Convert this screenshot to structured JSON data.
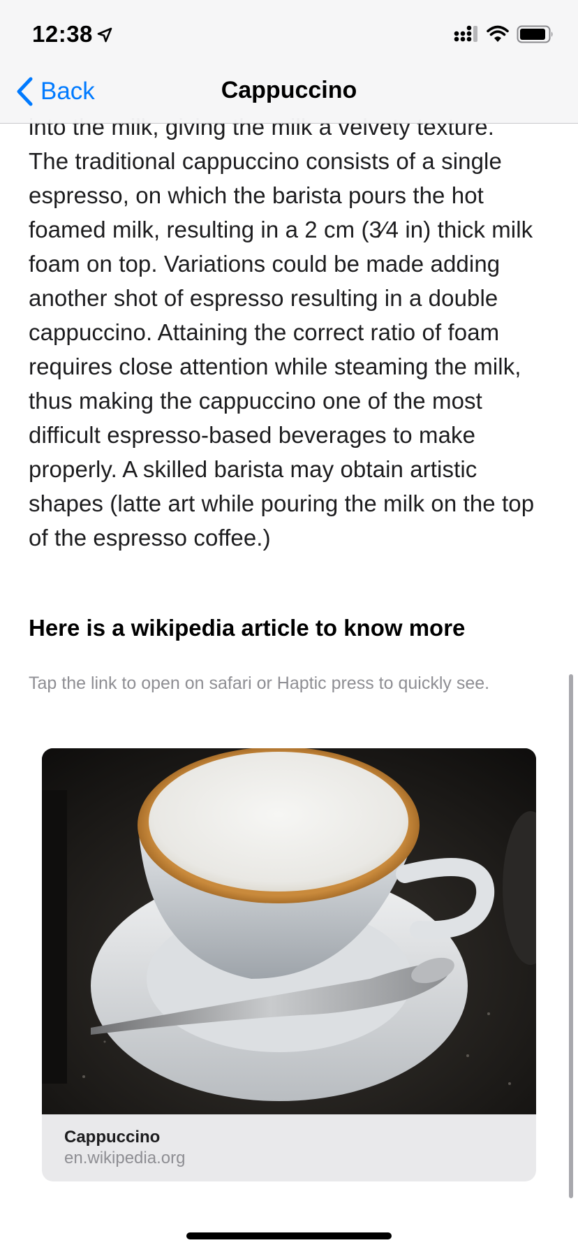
{
  "status_bar": {
    "time": "12:38"
  },
  "nav": {
    "back_label": "Back",
    "title": "Cappuccino"
  },
  "article": {
    "lines": [
      "into the milk, giving the milk a velvety texture.",
      "The traditional cappuccino consists of a single",
      "espresso, on which the barista pours the hot",
      "foamed milk, resulting in a 2 cm (3⁄4 in) thick milk",
      "foam on top. Variations could be made adding",
      "another shot of espresso resulting in a double",
      "cappuccino. Attaining the correct ratio of foam",
      "requires close attention while steaming the milk,",
      "thus making the cappuccino one of the most",
      "difficult espresso-based beverages to make",
      "properly. A skilled barista may obtain artistic",
      "shapes (latte art while pouring the milk on the top",
      "of the espresso coffee.)"
    ]
  },
  "section": {
    "heading": "Here is a wikipedia article to know more",
    "hint": "Tap the link to open on safari or Haptic press to quickly see."
  },
  "link_card": {
    "title": "Cappuccino",
    "domain": "en.wikipedia.org"
  },
  "colors": {
    "accent": "#007aff",
    "secondary_text": "#8e8e93",
    "card_background": "#e9e9eb"
  },
  "icons": {
    "location": "location-arrow-icon",
    "signal": "cellular-signal-icon",
    "wifi": "wifi-icon",
    "battery": "battery-icon",
    "back": "chevron-left-icon"
  }
}
